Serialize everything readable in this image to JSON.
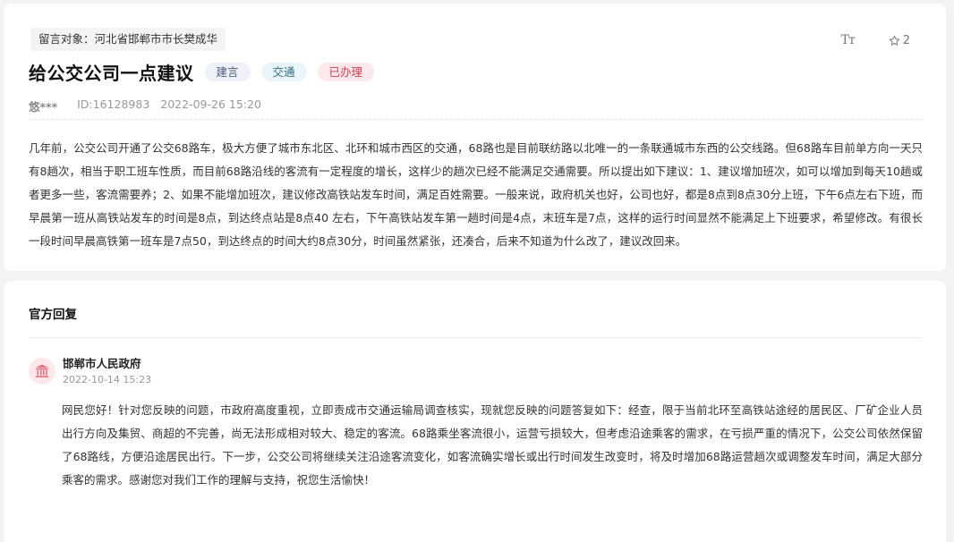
{
  "message": {
    "target": "留言对象：河北省邯郸市市长樊成华",
    "font_size_icon": "Tт",
    "favorite_count": "2",
    "title": "给公交公司一点建议",
    "tags": [
      {
        "label": "建言",
        "color": "#4a5a7c"
      },
      {
        "label": "交通",
        "color": "#2f6f86"
      },
      {
        "label": "已办理",
        "color": "#d13c52"
      }
    ],
    "user": "悠***",
    "id": "ID:16128983",
    "datetime": "2022-09-26 15:20",
    "content": "几年前，公交公司开通了公交68路车，极大方便了城市东北区、北环和城市西区的交通，68路也是目前联纺路以北唯一的一条联通城市东西的公交线路。但68路车目前单方向一天只有8趟次，相当于职工班车性质，而目前68路沿线的客流有一定程度的增长，这样少的趟次已经不能满足交通需要。所以提出如下建议：1、建议增加班次，如可以增加到每天10趟或者更多一些，客流需要养；2、如果不能增加班次，建议修改高铁站发车时间，满足百姓需要。一般来说，政府机关也好，公司也好，都是8点到8点30分上班，下午6点左右下班，而早晨第一班从高铁站发车的时间是8点，到达终点站是8点40 左右，下午高铁站发车第一趟时间是4点，末班车是7点，这样的运行时间显然不能满足上下班要求，希望修改。有很长一段时间早晨高铁第一班车是7点50，到达终点的时间大约8点30分，时间虽然紧张，还凑合，后来不知道为什么改了，建议改回来。"
  },
  "reply": {
    "section_title": "官方回复",
    "responder": "邯郸市人民政府",
    "datetime": "2022-10-14 15:23",
    "content": "网民您好！针对您反映的问题，市政府高度重视，立即责成市交通运输局调查核实，现就您反映的问题答复如下：经查，限于当前北环至高铁站途经的居民区、厂矿企业人员出行方向及集贸、商超的不完善，尚无法形成相对较大、稳定的客流。68路乘坐客流很小，运营亏损较大，但考虑沿途乘客的需求，在亏损严重的情况下，公交公司依然保留了68路线，方便沿途居民出行。下一步，公交公司将继续关注沿途客流变化，如客流确实增长或出行时间发生改变时，将及时增加68路运营趟次或调整发车时间，满足大部分乘客的需求。感谢您对我们工作的理解与支持，祝您生活愉快！",
    "icon": "government-building-icon",
    "icon_color": "#e8707c"
  }
}
